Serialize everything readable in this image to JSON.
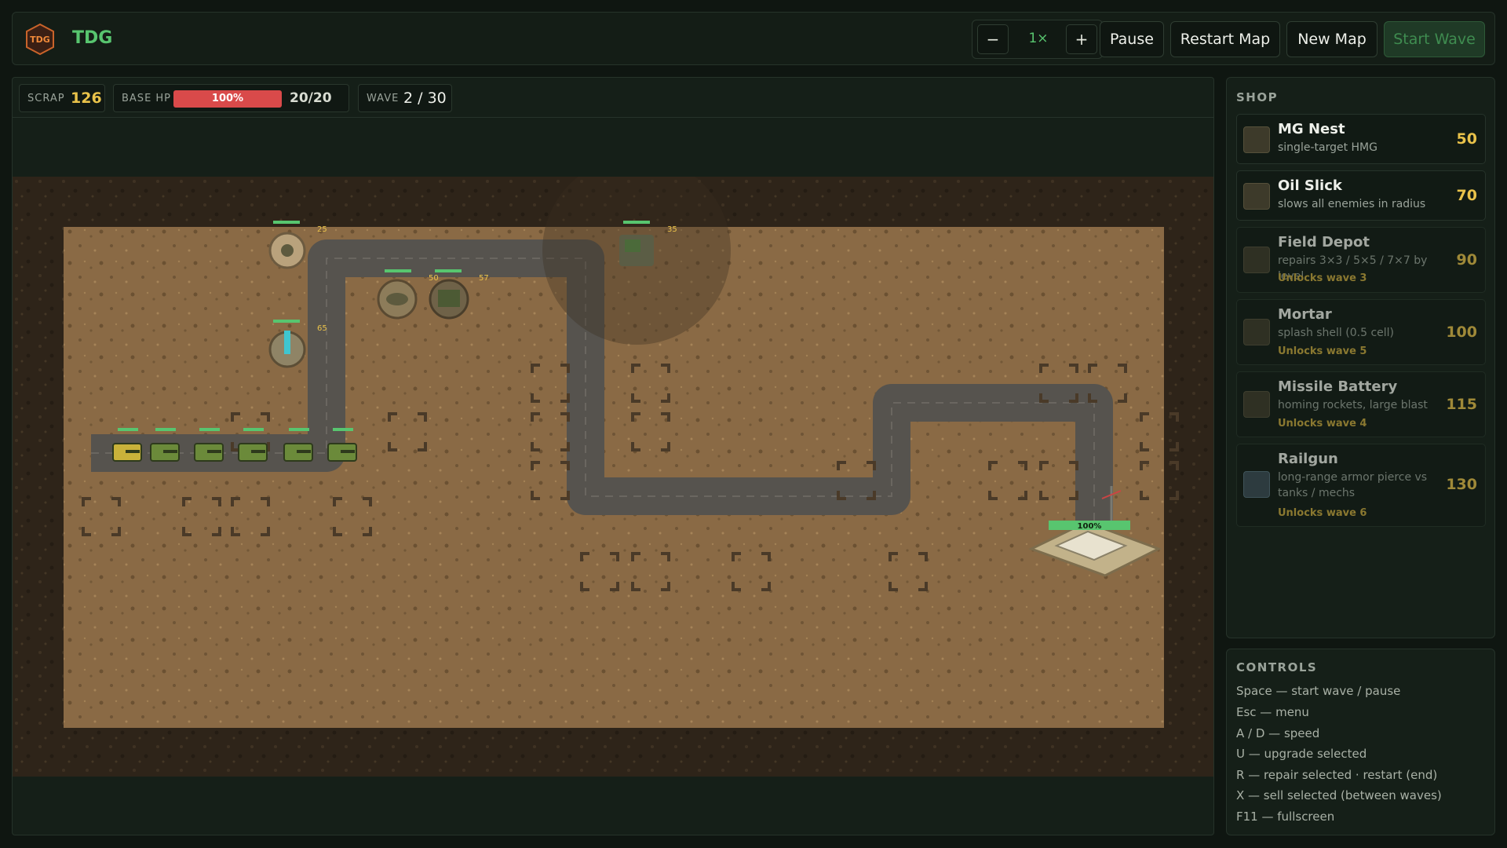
{
  "header": {
    "title": "TDG",
    "logo_text": "TDG",
    "speed": {
      "minus": "−",
      "value": "1×",
      "plus": "+"
    },
    "buttons": {
      "pause": "Pause",
      "restart": "Restart Map",
      "new_map": "New Map",
      "start_wave": "Start Wave"
    }
  },
  "stats": {
    "scrap_label": "SCRAP",
    "scrap_value": "126",
    "base_hp_label": "BASE HP",
    "base_hp_percent": "100%",
    "base_hp_fraction": 1.0,
    "base_hp_value": "20/20",
    "wave_label": "WAVE",
    "wave_value": "2 / 30"
  },
  "map": {
    "base_health_label": "100%",
    "tower_levels": [
      "25",
      "35",
      "50",
      "57",
      "65"
    ]
  },
  "shop": {
    "title": "SHOP",
    "items": [
      {
        "name": "MG Nest",
        "desc": "single-target HMG",
        "cost": "50",
        "unlock": "",
        "icon": "mg-nest-icon"
      },
      {
        "name": "Oil Slick",
        "desc": "slows all enemies in radius",
        "cost": "70",
        "unlock": "",
        "icon": "oil-slick-icon"
      },
      {
        "name": "Field Depot",
        "desc": "repairs 3×3 / 5×5 / 7×7 by level",
        "cost": "90",
        "unlock": "Unlocks wave 3",
        "icon": "field-depot-icon"
      },
      {
        "name": "Mortar",
        "desc": "splash shell (0.5 cell)",
        "cost": "100",
        "unlock": "Unlocks wave 5",
        "icon": "mortar-icon"
      },
      {
        "name": "Missile Battery",
        "desc": "homing rockets, large blast",
        "cost": "115",
        "unlock": "Unlocks wave 4",
        "icon": "missile-battery-icon"
      },
      {
        "name": "Railgun",
        "desc": "long-range armor pierce vs tanks / mechs",
        "cost": "130",
        "unlock": "Unlocks wave 6",
        "icon": "railgun-icon"
      }
    ]
  },
  "controls": {
    "title": "CONTROLS",
    "lines": [
      "Space — start wave / pause",
      "Esc — menu",
      "A / D — speed",
      "U — upgrade selected",
      "R — repair selected · restart (end)",
      "X — sell selected (between waves)",
      "F11 — fullscreen"
    ]
  },
  "colors": {
    "accent": "#58c56f",
    "cost": "#e9c24a",
    "hp": "#d94a4a",
    "unlock": "#c9a83e"
  }
}
